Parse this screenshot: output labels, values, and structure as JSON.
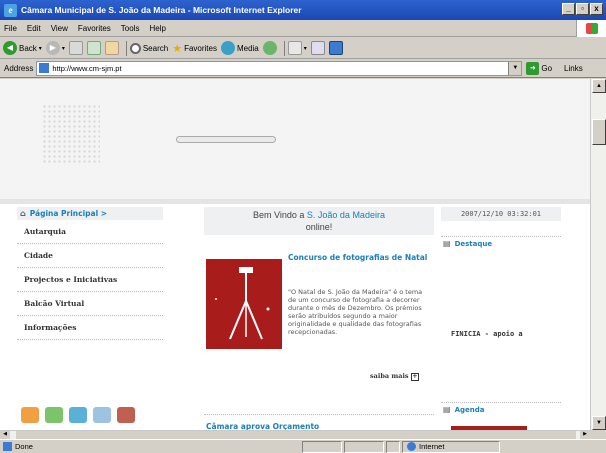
{
  "window": {
    "title": "Câmara Municipal de S. João da Madeira - Microsoft Internet Explorer",
    "buttons": {
      "minimize": "_",
      "maximize": "▫",
      "close": "x"
    }
  },
  "menu": [
    "File",
    "Edit",
    "View",
    "Favorites",
    "Tools",
    "Help"
  ],
  "toolbar": {
    "back": "Back",
    "search": "Search",
    "favorites": "Favorites",
    "media": "Media"
  },
  "address": {
    "label": "Address",
    "url": "http://www.cm-sjm.pt",
    "go": "Go",
    "links": "Links"
  },
  "nav": {
    "home": "Página Principal >",
    "items": [
      "Autarquia",
      "Cidade",
      "Projectos e Iniciativas",
      "Balcão Virtual",
      "Informações"
    ]
  },
  "welcome": {
    "prefix": "Bem Vindo a ",
    "highlight": "S. João da Madeira",
    "suffix": "online!"
  },
  "news": [
    {
      "title": "Concurso de fotografias de Natal",
      "body": "\"O Natal de S. João da Madeira\" é o tema de um concurso de fotografia a decorrer durante o mês de Dezembro. Os prémios serão atribuídos segundo a maior originalidade e qualidade das fotografias recepcionadas.",
      "more": "saiba mais"
    },
    {
      "title": "Câmara aprova Orçamento"
    }
  ],
  "datetime": "2007/12/10 03:32:01",
  "destaque": {
    "title": "Destaque",
    "text": "FINICIA - apoio a"
  },
  "agenda": {
    "title": "Agenda"
  },
  "status": {
    "left": "Done",
    "zone": "Internet"
  },
  "colors": {
    "accent": "#1a7fb7",
    "news_image": "#a81c1c",
    "titlebar": "#1a48b4"
  }
}
